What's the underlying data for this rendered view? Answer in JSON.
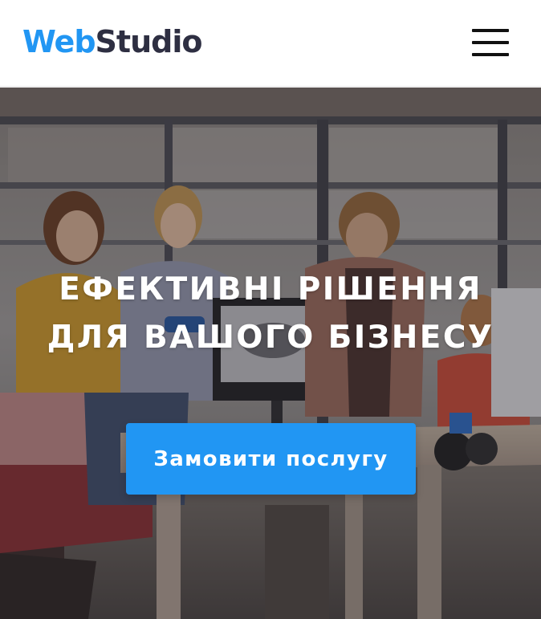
{
  "header": {
    "logo_part1": "Web",
    "logo_part2": "Studio",
    "menu_icon": "hamburger-menu-icon"
  },
  "hero": {
    "title_line1": "ЕФЕКТИВНІ РІШЕННЯ",
    "title_line2": "ДЛЯ ВАШОГО БІЗНЕСУ",
    "cta_label": "Замовити послугу",
    "background": "office-team-photo"
  },
  "colors": {
    "accent": "#2196f3",
    "logo_dark": "#2e2f42",
    "header_bg": "#ffffff",
    "hero_text": "#ffffff"
  }
}
